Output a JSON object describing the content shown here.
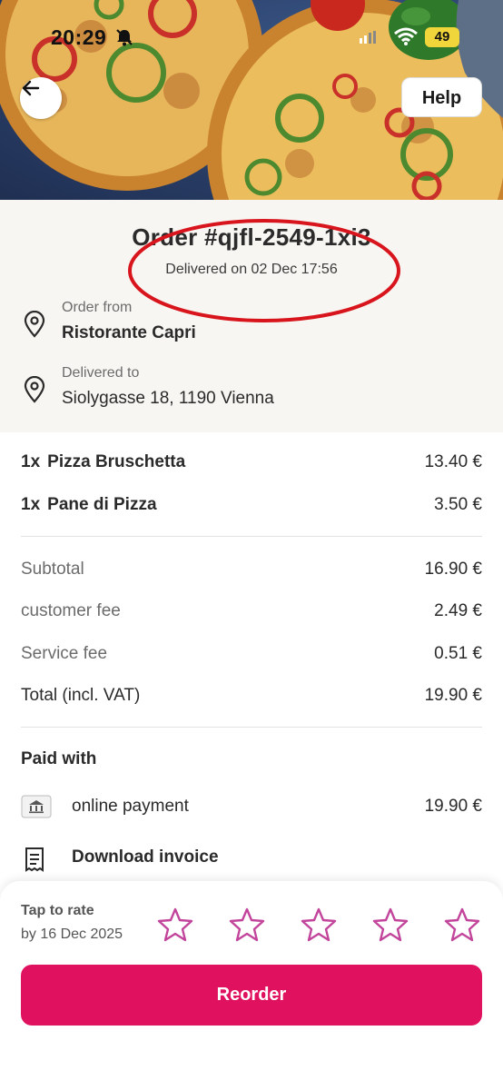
{
  "status_bar": {
    "time": "20:29",
    "battery": "49"
  },
  "header": {
    "help_label": "Help"
  },
  "order": {
    "title": "Order #qjfl-2549-1xi3",
    "delivered_on": "Delivered on 02 Dec 17:56",
    "from_label": "Order from",
    "from_value": "Ristorante Capri",
    "to_label": "Delivered to",
    "to_value": "Siolygasse 18, 1190 Vienna"
  },
  "items": [
    {
      "qty": "1x",
      "name": "Pizza Bruschetta",
      "price": "13.40 €"
    },
    {
      "qty": "1x",
      "name": "Pane di Pizza",
      "price": "3.50 €"
    }
  ],
  "summary": [
    {
      "label": "Subtotal",
      "value": "16.90 €"
    },
    {
      "label": "customer fee",
      "value": "2.49 €"
    },
    {
      "label": "Service fee",
      "value": "0.51 €"
    },
    {
      "label": "Total (incl. VAT)",
      "value": "19.90 €"
    }
  ],
  "payment": {
    "heading": "Paid with",
    "method": "online payment",
    "amount": "19.90 €",
    "invoice_label": "Download invoice"
  },
  "rating": {
    "title": "Tap to rate",
    "deadline": "by 16 Dec 2025",
    "max_stars": 5,
    "star_color": "#c2459b"
  },
  "actions": {
    "reorder_label": "Reorder"
  },
  "colors": {
    "accent": "#e0115f",
    "annotation": "#d8141c",
    "info_bg": "#f8f6f2"
  },
  "icons": [
    "bell-slash-icon",
    "signal-icon",
    "wifi-icon",
    "arrow-left-icon",
    "location-pin-icon",
    "bank-icon",
    "receipt-icon",
    "star-icon"
  ]
}
